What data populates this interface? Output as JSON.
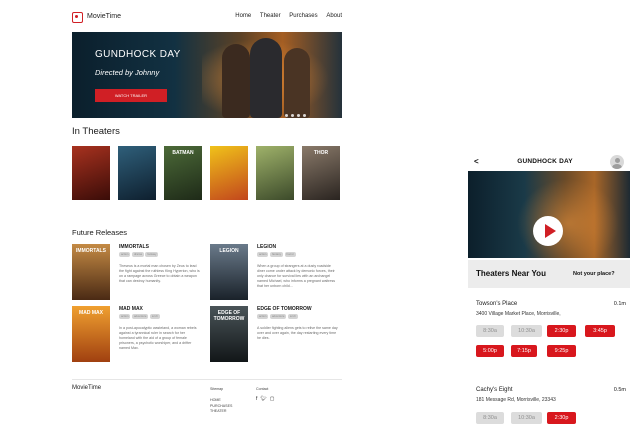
{
  "colors": {
    "accent": "#d01f25",
    "slot_available": "#d8171d",
    "slot_unavailable": "#dcdcdc"
  },
  "desktop": {
    "nav": {
      "brand": "MovieTime",
      "links": [
        "Home",
        "Theater",
        "Purchases",
        "About"
      ]
    },
    "hero": {
      "title": "GUNDHOCK DAY",
      "subtitle": "Directed by Johnny",
      "button": "WATCH TRAILER"
    },
    "in_theaters": {
      "heading": "In Theaters",
      "posters": [
        {
          "title": "",
          "color": "#6a1a14"
        },
        {
          "title": "",
          "color": "#1c3a55"
        },
        {
          "title": "BATMAN",
          "color": "#3c5030"
        },
        {
          "title": "",
          "color": "#d9a417"
        },
        {
          "title": "",
          "color": "#5a6a3a"
        },
        {
          "title": "THOR",
          "color": "#6a5a50"
        }
      ]
    },
    "future_releases": {
      "heading": "Future Releases",
      "items": [
        {
          "title": "IMMORTALS",
          "poster_text": "IMMORTALS",
          "poster_color": "#8a5a2a",
          "tags": [
            "action",
            "drama",
            "fantasy"
          ],
          "description": "Theseus is a mortal man chosen by Zeus to lead the fight against the ruthless King Hyperion, who is on a rampage across Greece to obtain a weapon that can destroy humanity."
        },
        {
          "title": "LEGION",
          "poster_text": "LEGION",
          "poster_color": "#3a4a5a",
          "tags": [
            "action",
            "fantasy",
            "horror"
          ],
          "description": "When a group of strangers at a dusty roadside diner come under attack by demonic forces, their only chance for survival lies with an archangel named Michael, who informs a pregnant waitress that her unborn child..."
        },
        {
          "title": "MAD MAX",
          "poster_text": "MAD MAX",
          "poster_color": "#d9761a",
          "tags": [
            "action",
            "adventure",
            "sci-fi"
          ],
          "description": "In a post-apocalyptic wasteland, a woman rebels against a tyrannical ruler in search for her homeland with the aid of a group of female prisoners, a psychotic worshiper, and a drifter named Max."
        },
        {
          "title": "EDGE OF TOMORROW",
          "poster_text": "EDGE OF TOMORROW",
          "poster_color": "#2a3438",
          "tags": [
            "action",
            "adventure",
            "sci-fi"
          ],
          "description": "A soldier fighting aliens gets to relive the same day over and over again, the day restarting every time he dies."
        }
      ]
    },
    "footer": {
      "brand": "MovieTime",
      "sitemap_heading": "Sitemap",
      "sitemap_links": [
        "HOME",
        "PURCHASES",
        "THEATER"
      ],
      "contact_heading": "Contact",
      "social_icons": [
        "facebook-icon",
        "twitter-icon",
        "chat-icon"
      ]
    }
  },
  "mobile": {
    "header": {
      "title": "GUNDHOCK DAY"
    },
    "near_you": {
      "heading": "Theaters Near You",
      "link": "Not your place?"
    },
    "theaters": [
      {
        "name": "Towson's Place",
        "distance": "0.1m",
        "address": "3400 Village Market Place, Morrisville,",
        "times": [
          {
            "label": "8:30a",
            "available": false
          },
          {
            "label": "10:30a",
            "available": false
          },
          {
            "label": "2:30p",
            "available": true
          },
          {
            "label": "3:45p",
            "available": true
          },
          {
            "label": "5:00p",
            "available": true
          },
          {
            "label": "7:15p",
            "available": true
          },
          {
            "label": "9:25p",
            "available": true
          }
        ]
      },
      {
        "name": "Cachy's Eight",
        "distance": "0.5m",
        "address": "181 Message Rd, Morrisville, 23343",
        "times": [
          {
            "label": "8:30a",
            "available": false
          },
          {
            "label": "10:30a",
            "available": false
          },
          {
            "label": "2:30p",
            "available": true
          }
        ]
      }
    ]
  }
}
